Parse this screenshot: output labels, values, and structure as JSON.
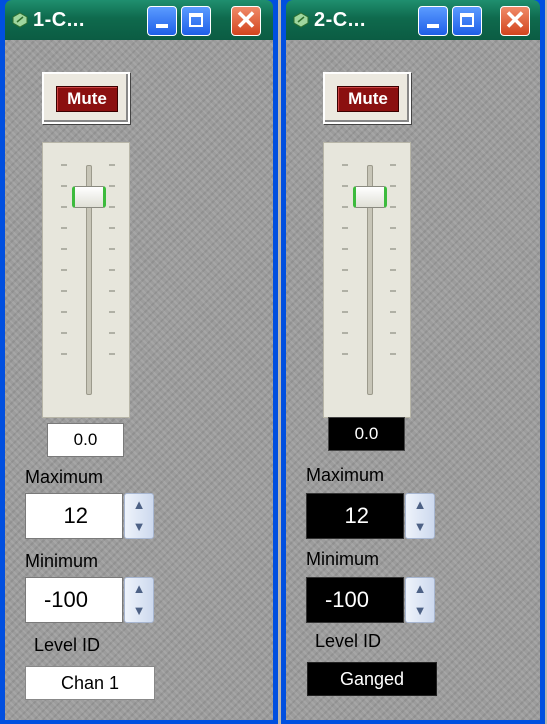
{
  "windows": [
    {
      "title": "1-C...",
      "mute_label": "Mute",
      "fader_value": "0.0",
      "maximum_label": "Maximum",
      "maximum_value": "12",
      "minimum_label": "Minimum",
      "minimum_value": "-100",
      "level_id_label": "Level ID",
      "level_id_value": "Chan  1",
      "fader_level_fraction": 0.9
    },
    {
      "title": "2-C...",
      "mute_label": "Mute",
      "fader_value": "0.0",
      "maximum_label": "Maximum",
      "maximum_value": "12",
      "minimum_label": "Minimum",
      "minimum_value": "-100",
      "level_id_label": "Level ID",
      "level_id_value": "Ganged",
      "fader_level_fraction": 0.9
    }
  ],
  "titlebar_buttons": {
    "close_glyph": "✕"
  },
  "spin": {
    "up": "▲",
    "down": "▼"
  },
  "colors": {
    "window_frame": "#004fe0",
    "titlebar": "#0f6a4d",
    "mute_button": "#8b1010",
    "thumb_accent": "#3dbb3d"
  },
  "icons": [
    "window-app-icon",
    "minimize-icon",
    "maximize-icon",
    "close-icon",
    "spin-up-icon",
    "spin-down-icon"
  ]
}
